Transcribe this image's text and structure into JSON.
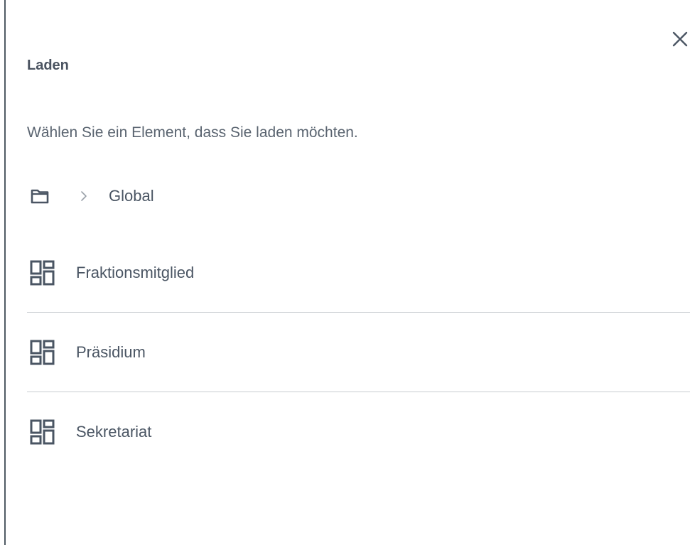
{
  "dialog": {
    "title": "Laden",
    "subtitle": "Wählen Sie ein Element, dass Sie laden möchten.",
    "close_icon": "close-icon"
  },
  "breadcrumb": {
    "root_icon": "folder-icon",
    "separator_icon": "chevron-right-icon",
    "current": "Global"
  },
  "items": [
    {
      "label": "Fraktionsmitglied",
      "icon": "dashboard-icon"
    },
    {
      "label": "Präsidium",
      "icon": "dashboard-icon"
    },
    {
      "label": "Sekretariat",
      "icon": "dashboard-icon"
    }
  ],
  "colors": {
    "text": "#4a5563",
    "divider": "#c8ccd0",
    "background": "#ffffff"
  }
}
